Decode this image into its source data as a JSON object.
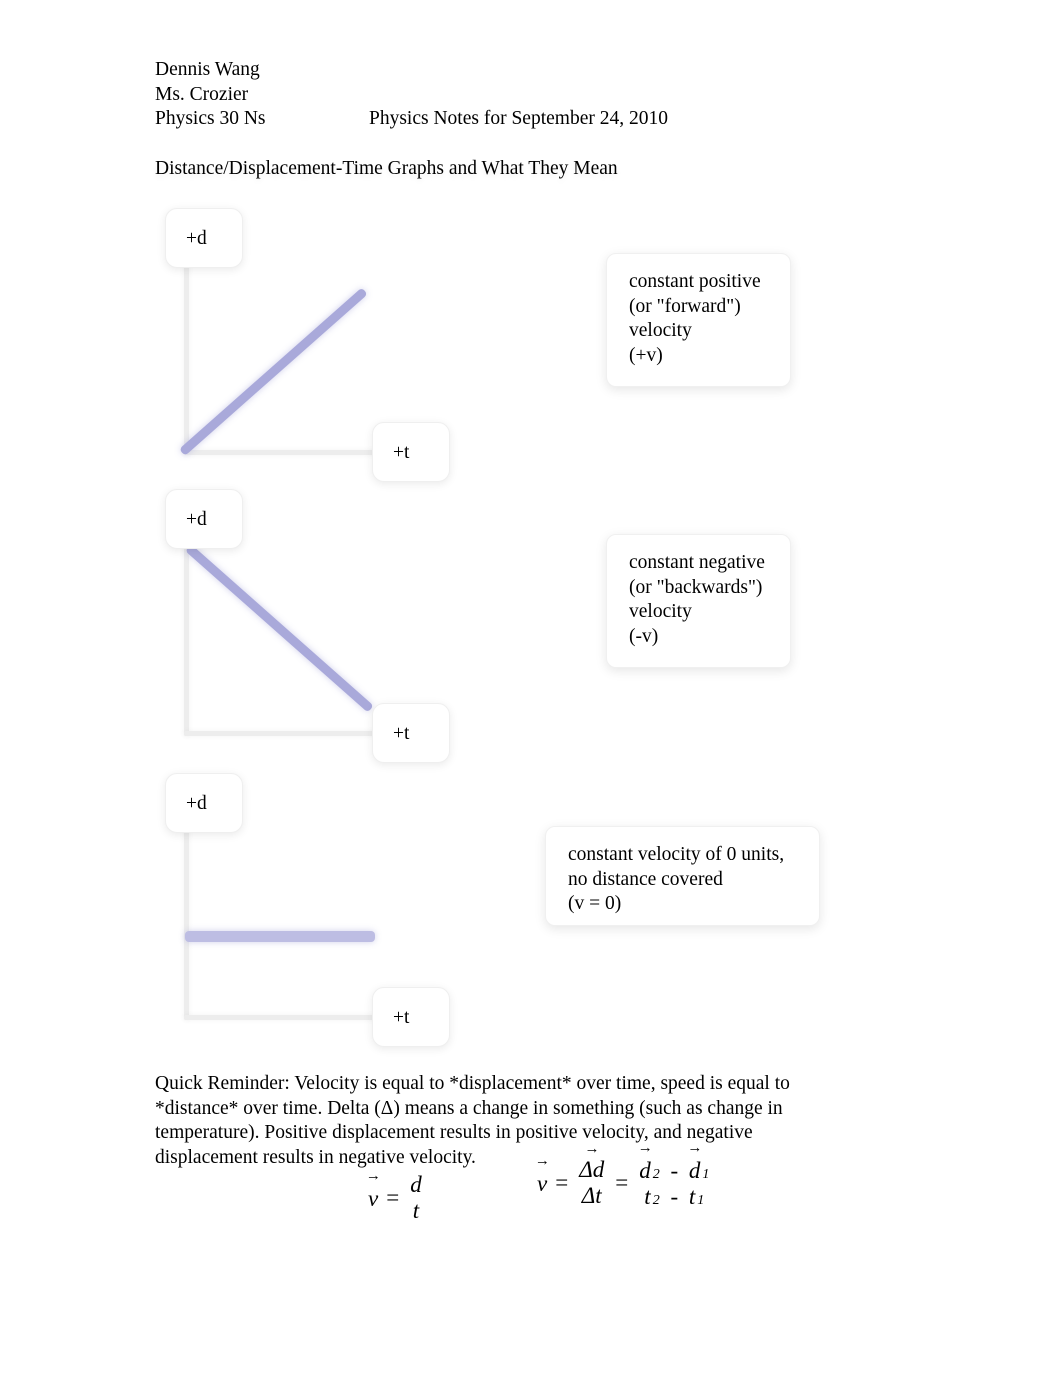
{
  "header": {
    "student_name": "Dennis Wang",
    "teacher": "Ms. Crozier",
    "course": "Physics 30 Ns",
    "notes_title": "Physics Notes for September 24, 2010"
  },
  "document": {
    "title": "Distance/Displacement-Time Graphs and What They Mean"
  },
  "figures": [
    {
      "id": "graph-constant-positive-velocity",
      "y_axis_label": "+d",
      "x_axis_label": "+t",
      "line_type": "ascending",
      "line_color": "#a9a9da",
      "callout": "constant positive\n(or \"forward\")\nvelocity\n(+v)"
    },
    {
      "id": "graph-constant-negative-velocity",
      "y_axis_label": "+d",
      "x_axis_label": "+t",
      "line_type": "descending",
      "line_color": "#a9a9da",
      "callout": "constant negative\n(or \"backwards\")\nvelocity\n(-v)"
    },
    {
      "id": "graph-zero-velocity",
      "y_axis_label": "+d",
      "x_axis_label": "+t",
      "line_type": "flat",
      "line_color": "#bdbde3",
      "callout": "constant velocity of 0 units,\nno distance covered\n(v = 0)"
    }
  ],
  "body": {
    "reminder": "Quick Reminder: Velocity is equal to *displacement* over time, speed is equal to *distance* over time. Delta (Δ) means a change in something (such as change in temperature). Positive displacement results in positive velocity, and negative displacement results in negative velocity."
  },
  "formulas": {
    "simple": {
      "v": "v",
      "equals": "=",
      "numerator": "d",
      "denominator": "t"
    },
    "delta": {
      "v": "v",
      "equals1": "=",
      "numerator": "Δd",
      "denominator": "Δt",
      "equals2": "=",
      "num_term1": "d",
      "num_sub1": "2",
      "num_minus": "-",
      "num_term2": "d",
      "num_sub2": "1",
      "den_term1": "t",
      "den_sub1": "2",
      "den_minus": "-",
      "den_term2": "t",
      "den_sub2": "1"
    }
  },
  "colors": {
    "line_blue": "#a9a9da",
    "line_blue_light": "#bdbde3",
    "axis_gray": "#ededed",
    "text": "#000000",
    "page_background": "#ffffff"
  }
}
